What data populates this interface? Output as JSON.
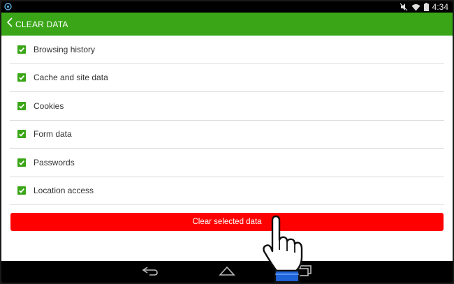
{
  "status_bar": {
    "time": "4:34",
    "icons": [
      "app-notification-icon",
      "mute-icon",
      "wifi-icon",
      "battery-icon"
    ]
  },
  "action_bar": {
    "title": "CLEAR DATA",
    "back_icon": "chevron-left-icon"
  },
  "options": [
    {
      "label": "Browsing history",
      "checked": true
    },
    {
      "label": "Cache and site data",
      "checked": true
    },
    {
      "label": "Cookies",
      "checked": true
    },
    {
      "label": "Form data",
      "checked": true
    },
    {
      "label": "Passwords",
      "checked": true
    },
    {
      "label": "Location access",
      "checked": true
    }
  ],
  "clear_button": {
    "label": "Clear selected data"
  },
  "nav_bar": {
    "icons": [
      "back-icon",
      "home-icon",
      "recent-apps-icon"
    ]
  },
  "colors": {
    "accent_green": "#3aa617",
    "button_red": "#ff0000"
  }
}
